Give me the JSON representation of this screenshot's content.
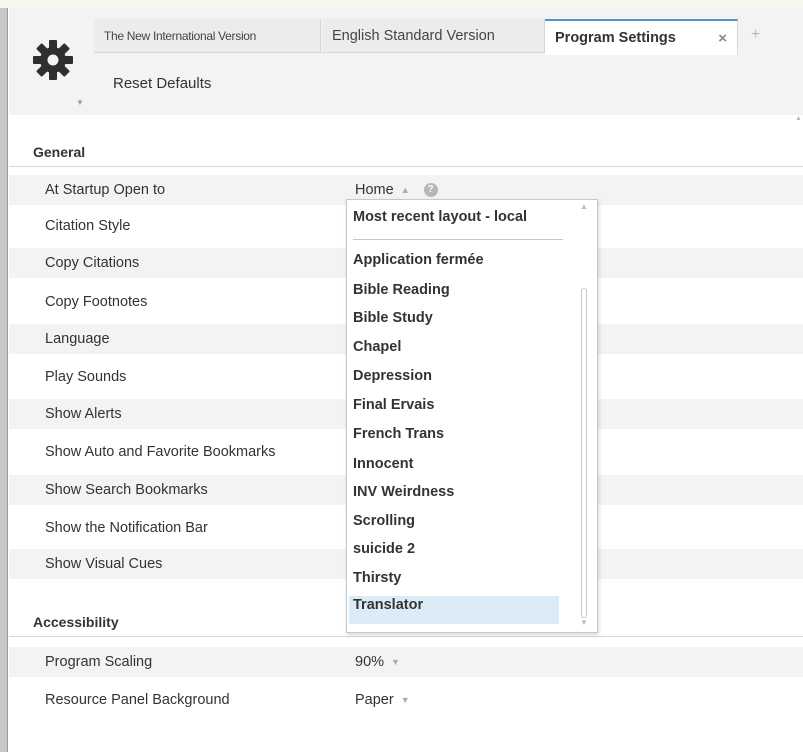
{
  "tabs": [
    {
      "label": "The New International Version"
    },
    {
      "label": "English Standard Version"
    },
    {
      "label": "Program Settings",
      "close": "×"
    }
  ],
  "add_tab": "+",
  "toolbar": {
    "reset_label": "Reset Defaults"
  },
  "sections": {
    "general": "General",
    "accessibility": "Accessibility"
  },
  "general_rows": [
    {
      "label": "At Startup Open to",
      "value": "Home",
      "help": "?"
    },
    {
      "label": "Citation Style"
    },
    {
      "label": "Copy Citations"
    },
    {
      "label": "Copy Footnotes"
    },
    {
      "label": "Language"
    },
    {
      "label": "Play Sounds"
    },
    {
      "label": "Show Alerts"
    },
    {
      "label": "Show Auto and Favorite Bookmarks"
    },
    {
      "label": "Show Search Bookmarks"
    },
    {
      "label": "Show the Notification Bar"
    },
    {
      "label": "Show Visual Cues"
    }
  ],
  "accessibility_rows": [
    {
      "label": "Program Scaling",
      "value": "90%"
    },
    {
      "label": "Resource Panel Background",
      "value": "Paper"
    }
  ],
  "dropdown": {
    "first": "Most recent layout - local",
    "items": [
      "Application fermée",
      "Bible Reading",
      "Bible Study",
      "Chapel",
      "Depression",
      "Final Ervais",
      "French Trans",
      "Innocent",
      "INV Weirdness",
      "Scrolling",
      "suicide 2",
      "Thirsty",
      "Translator"
    ],
    "selected": "Translator"
  },
  "colors": {
    "accent": "#5a8fc7",
    "selected_bg": "#dcecf6",
    "alt_row": "#f3f3f3"
  }
}
